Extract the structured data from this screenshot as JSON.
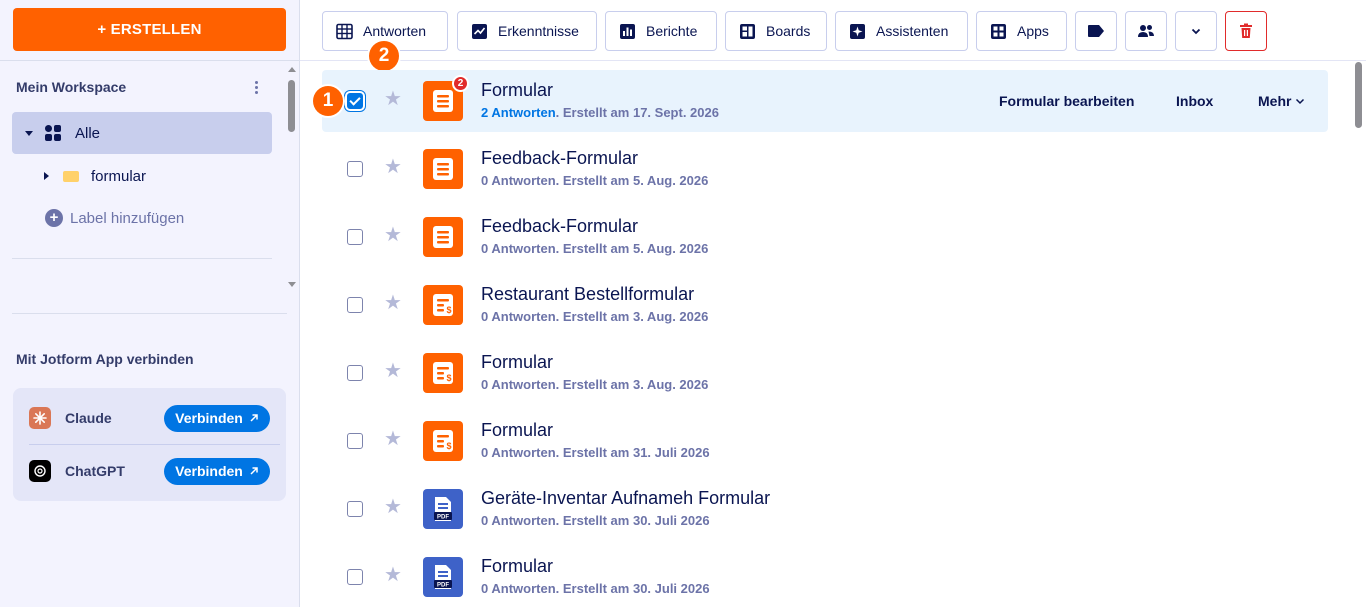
{
  "sidebar": {
    "create_label": "+ ERSTELLEN",
    "workspace_title": "Mein Workspace",
    "nav_all_label": "Alle",
    "folder_label": "formular",
    "add_label_text": "Label hinzufügen",
    "connect_title": "Mit Jotform App verbinden",
    "apps": [
      {
        "name": "Claude",
        "button": "Verbinden"
      },
      {
        "name": "ChatGPT",
        "button": "Verbinden"
      }
    ]
  },
  "toolbar": {
    "answers": "Antworten",
    "insights": "Erkenntnisse",
    "reports": "Berichte",
    "boards": "Boards",
    "assistants": "Assistenten",
    "apps": "Apps"
  },
  "step_badges": [
    "1",
    "2"
  ],
  "forms": [
    {
      "title": "Formular",
      "count": "2 Antworten",
      "created": "Erstellt am 17. Sept. 2026",
      "icon": "form-icon",
      "color": "orange",
      "unread": "2",
      "checked": true
    },
    {
      "title": "Feedback-Formular",
      "count": "0 Antworten",
      "created": "Erstellt am 5. Aug. 2026",
      "icon": "form-icon",
      "color": "orange"
    },
    {
      "title": "Feedback-Formular",
      "count": "0 Antworten",
      "created": "Erstellt am 5. Aug. 2026",
      "icon": "form-icon",
      "color": "orange"
    },
    {
      "title": "Restaurant Bestellformular",
      "count": "0 Antworten",
      "created": "Erstellt am 3. Aug. 2026",
      "icon": "payment-form-icon",
      "color": "orange"
    },
    {
      "title": "Formular",
      "count": "0 Antworten",
      "created": "Erstellt am 3. Aug. 2026",
      "icon": "payment-form-icon",
      "color": "orange"
    },
    {
      "title": "Formular",
      "count": "0 Antworten",
      "created": "Erstellt am 31. Juli 2026",
      "icon": "payment-form-icon",
      "color": "orange"
    },
    {
      "title": "Geräte-Inventar Aufnameh Formular",
      "count": "0 Antworten",
      "created": "Erstellt am 30. Juli 2026",
      "icon": "pdf-form-icon",
      "color": "blue"
    },
    {
      "title": "Formular",
      "count": "0 Antworten",
      "created": "Erstellt am 30. Juli 2026",
      "icon": "pdf-form-icon",
      "color": "blue"
    }
  ],
  "row_actions": {
    "edit": "Formular bearbeiten",
    "inbox": "Inbox",
    "more": "Mehr"
  },
  "colors": {
    "brand_orange": "#ff6100",
    "accent_blue": "#0075e3",
    "selected_row": "#e8f3fd",
    "danger": "#e12b2b"
  }
}
